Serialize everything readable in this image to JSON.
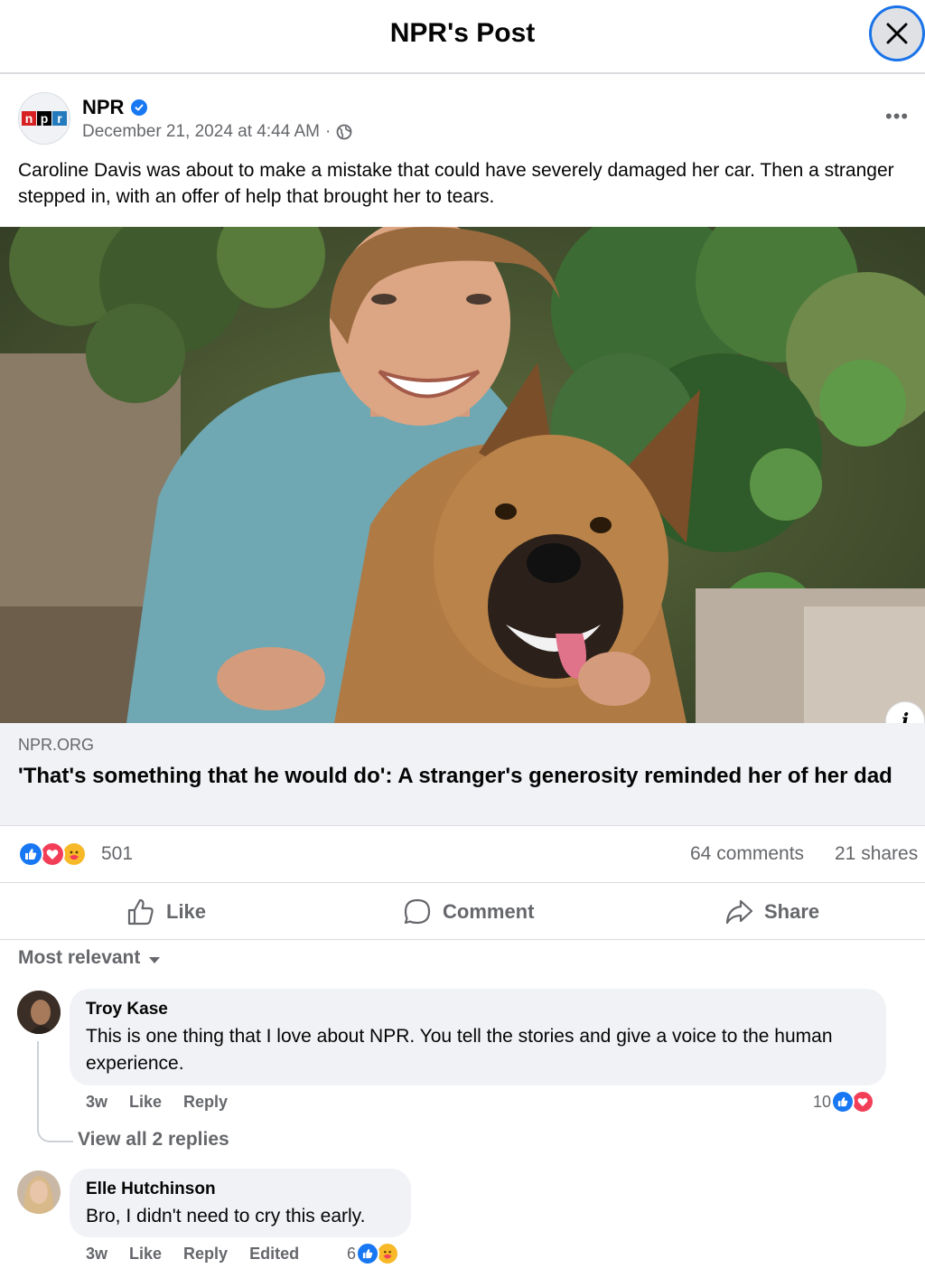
{
  "header": {
    "title": "NPR's Post",
    "close_icon": "close-icon"
  },
  "post": {
    "author": "NPR",
    "verified_icon": "verified-badge-icon",
    "logo_letters": [
      "n",
      "p",
      "r"
    ],
    "logo_colors": [
      "#d62021",
      "#000000",
      "#237bbd"
    ],
    "timestamp": "December 21, 2024 at 4:44 AM",
    "separator": "·",
    "privacy_icon": "globe-icon",
    "more_icon": "more-options-icon",
    "more_label": "•••",
    "text": "Caroline Davis was about to make a mistake that could have severely damaged her car. Then a stranger stepped in, with an offer of help that brought her to tears.",
    "info_label": "i"
  },
  "link": {
    "domain": "NPR.ORG",
    "title": "'That's something that he would do': A stranger's generosity reminded her of her dad"
  },
  "stats": {
    "reactions": "501",
    "comments": "64 comments",
    "shares": "21 shares",
    "reaction_icons": [
      "like-reaction-icon",
      "love-reaction-icon",
      "care-reaction-icon"
    ]
  },
  "actions": {
    "like": "Like",
    "comment": "Comment",
    "share": "Share"
  },
  "sort": {
    "label": "Most relevant"
  },
  "comments": [
    {
      "author": "Troy Kase",
      "text": "This is one thing that I love about NPR. You tell the stories and give a voice to the human experience.",
      "time": "3w",
      "like": "Like",
      "reply": "Reply",
      "reactions": "10",
      "view_replies": "View all 2 replies"
    },
    {
      "author": "Elle Hutchinson",
      "text": "Bro, I didn't need to cry this early.",
      "time": "3w",
      "like": "Like",
      "reply": "Reply",
      "edited": "Edited",
      "reactions": "6"
    }
  ],
  "colors": {
    "facebook_blue": "#1877f2",
    "love_red": "#f33e58",
    "care_yellow": "#f7b928",
    "secondary_text": "#65676b",
    "bubble_bg": "#f0f2f5"
  }
}
